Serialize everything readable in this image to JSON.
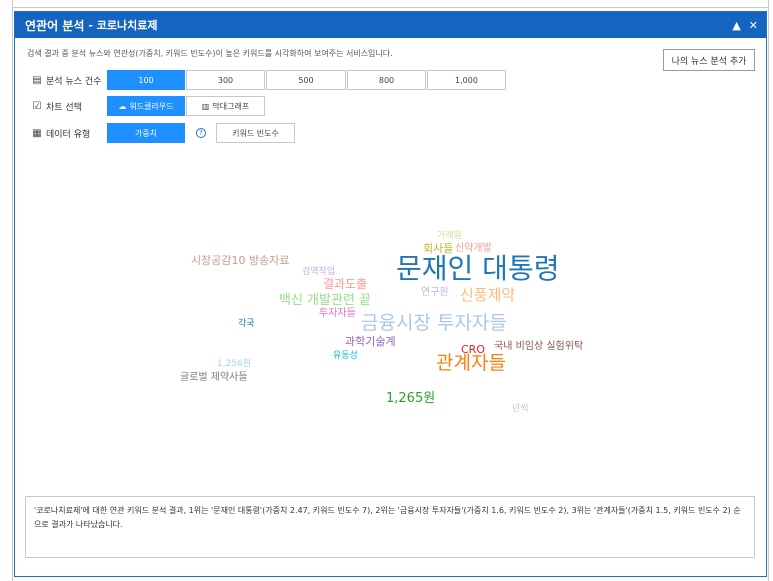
{
  "panel": {
    "title": "연관어 분석",
    "subtitle": "- 코로나치료제",
    "up_icon": "▲",
    "close_icon": "✕"
  },
  "description": "검색 결과 중 분석 뉴스와 연관성(가중치, 키워드 빈도수)이 높은 키워드를 시각화하여 보여주는 서비스입니다.",
  "my_news_button": "나의 뉴스 분석 추가",
  "news_count": {
    "label": "분석 뉴스 건수",
    "options": [
      "100",
      "300",
      "500",
      "800",
      "1,000"
    ],
    "selected": "100"
  },
  "chart_select": {
    "label": "차트 선택",
    "options": [
      "워드클라우드",
      "막대그래프"
    ],
    "selected": "워드클라우드"
  },
  "data_type": {
    "label": "데이터 유형",
    "options": [
      "가중치",
      "키워드 빈도수"
    ],
    "selected": "가중치",
    "help": "?"
  },
  "word_cloud": [
    {
      "text": "문재인 대통령",
      "color": "#1f77b4"
    },
    {
      "text": "금융시장 투자자들",
      "color": "#aec7e8"
    },
    {
      "text": "관계자들",
      "color": "#ff7f0e"
    },
    {
      "text": "신풍제약",
      "color": "#ffbb78"
    },
    {
      "text": "백신 개발관련 끝",
      "color": "#98df8a"
    },
    {
      "text": "1,265원",
      "color": "#2ca02c"
    },
    {
      "text": "결과도출",
      "color": "#ff9896"
    },
    {
      "text": "시장공감10 방송자료",
      "color": "#c49c94"
    },
    {
      "text": "회사들",
      "color": "#bcbd22"
    },
    {
      "text": "신약개발",
      "color": "#ff9896"
    },
    {
      "text": "거래일",
      "color": "#dbdb8d"
    },
    {
      "text": "연구원",
      "color": "#c5b0d5"
    },
    {
      "text": "검역작업",
      "color": "#c5b0d5"
    },
    {
      "text": "투자자들",
      "color": "#e377c2"
    },
    {
      "text": "각국",
      "color": "#1f77b4"
    },
    {
      "text": "과학기술계",
      "color": "#9467bd"
    },
    {
      "text": "CRO",
      "color": "#d62728"
    },
    {
      "text": "국내 비임상 실험위탁",
      "color": "#8c564b"
    },
    {
      "text": "유동성",
      "color": "#17becf"
    },
    {
      "text": "1,256원",
      "color": "#9edae5"
    },
    {
      "text": "글로벌 제약사들",
      "color": "#7f7f7f"
    },
    {
      "text": "년씩",
      "color": "#c7c7c7"
    }
  ],
  "summary": "'코로나치료제'에 대한 연관 키워드 분석 결과, 1위는 '문재인 대통령'(가중치 2.47, 키워드 빈도수 7), 2위는 '금융시장 투자자들'(가중치 1.6, 키워드 빈도수 2), 3위는 '관계자들'(가중치 1.5, 키워드 빈도수 2) 순으로 결과가 나타났습니다."
}
